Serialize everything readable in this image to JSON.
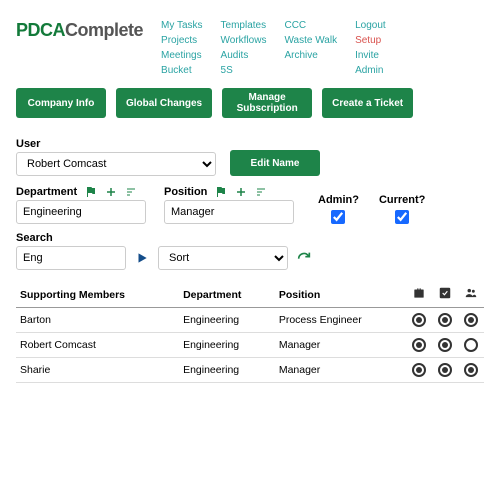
{
  "logo": {
    "part1": "PDCA",
    "part2": "Complete"
  },
  "nav": {
    "col1": [
      "My Tasks",
      "Projects",
      "Meetings",
      "Bucket"
    ],
    "col2": [
      "Templates",
      "Workflows",
      "Audits",
      "5S"
    ],
    "col3": [
      "CCC",
      "Waste Walk",
      "Archive"
    ],
    "col4": [
      "Logout",
      "Setup",
      "Invite",
      "Admin"
    ],
    "active": "Setup"
  },
  "buttons": {
    "company_info": "Company Info",
    "global_changes": "Global Changes",
    "manage_subscription": "Manage\nSubscription",
    "create_ticket": "Create a Ticket",
    "edit_name": "Edit Name"
  },
  "labels": {
    "user": "User",
    "department": "Department",
    "position": "Position",
    "admin": "Admin?",
    "current": "Current?",
    "search": "Search",
    "sort": "Sort",
    "supporting_members": "Supporting Members"
  },
  "form": {
    "user_value": "Robert Comcast",
    "department_value": "Engineering",
    "position_value": "Manager",
    "admin_checked": true,
    "current_checked": true,
    "search_value": "Eng"
  },
  "table": {
    "headers": {
      "name": "Supporting Members",
      "department": "Department",
      "position": "Position"
    },
    "rows": [
      {
        "name": "Barton",
        "department": "Engineering",
        "position": "Process Engineer",
        "r1": true,
        "r2": true,
        "r3": true
      },
      {
        "name": "Robert Comcast",
        "department": "Engineering",
        "position": "Manager",
        "r1": true,
        "r2": true,
        "r3": false
      },
      {
        "name": "Sharie",
        "department": "Engineering",
        "position": "Manager",
        "r1": true,
        "r2": true,
        "r3": true
      }
    ]
  }
}
